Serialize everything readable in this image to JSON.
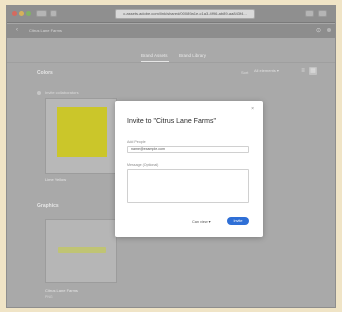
{
  "browser": {
    "url": "c.assets.adobe.com/link/shared/00089a1e-c1a3-4f96-ab89-aa843f4...",
    "lights": [
      "#d56a5f",
      "#d6b15a",
      "#82b365"
    ],
    "tab_hint": "+"
  },
  "app": {
    "back_icon": "chevron-left-icon",
    "title": "Citrus Lane Farms",
    "right_icons": [
      "help-icon",
      "avatar"
    ]
  },
  "tabs": [
    {
      "label": "Brand Assets",
      "active": true
    },
    {
      "label": "Brand Library",
      "active": false
    }
  ],
  "colors_section": {
    "title": "Colors",
    "invite_text": "Invite collaborators",
    "sort_label": "Sort",
    "sort_value": "All elements ▾",
    "card_label": "Lime Yellow",
    "swatch": "#cbc62a"
  },
  "graphics_section": {
    "title": "Graphics",
    "card_label": "Citrus Lane Farms",
    "card_sub": "PNG"
  },
  "modal": {
    "title": "Invite to \"Citrus Lane Farms\"",
    "close": "×",
    "email_label": "Add People",
    "email_value": "name@example.com",
    "message_label": "Message (Optional)",
    "message_value": "",
    "permission": "Can view ▾",
    "invite_button": "Invite"
  }
}
